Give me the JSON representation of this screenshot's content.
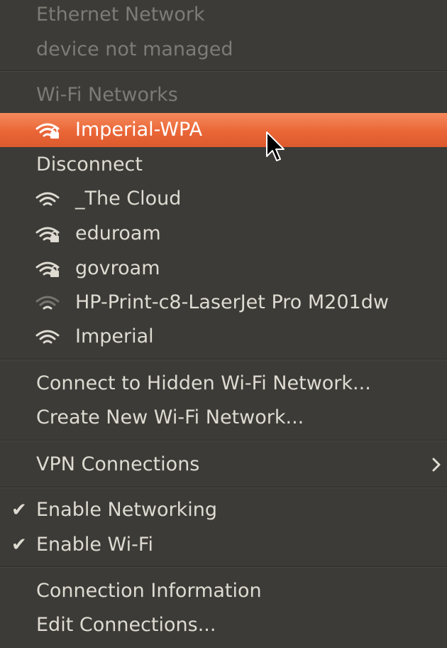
{
  "ethernet": {
    "title": "Ethernet Network",
    "status": "device not managed"
  },
  "wifi": {
    "title": "Wi-Fi Networks",
    "connected": {
      "name": "Imperial-WPA",
      "icon": "wifi-lock-icon",
      "highlight_color": "#e9673a"
    },
    "disconnect_label": "Disconnect",
    "networks": [
      {
        "name": "_The Cloud",
        "icon": "wifi-icon"
      },
      {
        "name": "eduroam",
        "icon": "wifi-lock-icon"
      },
      {
        "name": "govroam",
        "icon": "wifi-lock-icon"
      },
      {
        "name": "HP-Print-c8-LaserJet Pro M201dw",
        "icon": "wifi-weak-icon"
      },
      {
        "name": "Imperial",
        "icon": "wifi-icon"
      }
    ]
  },
  "actions": {
    "connect_hidden": "Connect to Hidden Wi-Fi Network...",
    "create_new": "Create New Wi-Fi Network..."
  },
  "vpn": {
    "label": "VPN Connections",
    "icon": "chevron-right-icon"
  },
  "toggles": {
    "check_glyph": "✔",
    "enable_networking": {
      "label": "Enable Networking",
      "checked": true
    },
    "enable_wifi": {
      "label": "Enable Wi-Fi",
      "checked": true
    }
  },
  "footer": {
    "connection_information": "Connection Information",
    "edit_connections": "Edit Connections..."
  }
}
